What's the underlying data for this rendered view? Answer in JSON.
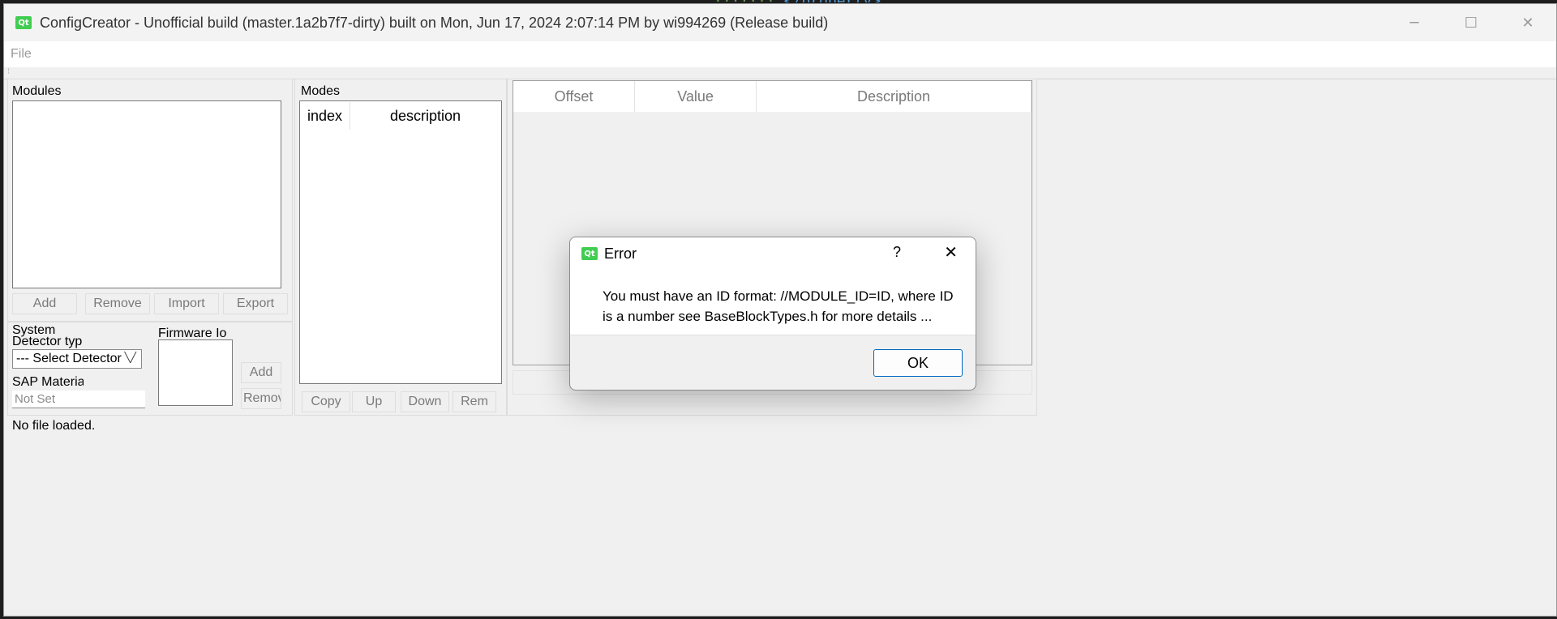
{
  "window": {
    "title": "ConfigCreator - Unofficial build (master.1a2b7f7-dirty) built on Mon, Jun 17, 2024  2:07:14 PM by wi994269 (Release build)",
    "logo": "Qt",
    "minimize_glyph": "─",
    "maximize_glyph": "☐",
    "close_glyph": "✕"
  },
  "menu": {
    "file": "File"
  },
  "modules": {
    "title": "Modules",
    "buttons": {
      "add": "Add",
      "remove": "Remove",
      "import": "Import",
      "export": "Export"
    }
  },
  "system": {
    "title": "System",
    "detector_type_label": "Detector typ",
    "detector_select_value": "--- Select Detector",
    "sap_material_label": "SAP Materia",
    "sap_material_placeholder": "Not Set",
    "firmware_label": "Firmware Io",
    "firmware_add": "Add",
    "firmware_remove": "Remov"
  },
  "modes": {
    "title": "Modes",
    "columns": {
      "index": "index",
      "description": "description"
    },
    "buttons": {
      "copy": "Copy",
      "up": "Up",
      "down": "Down",
      "remove": "Rem"
    }
  },
  "grid": {
    "columns": {
      "offset": "Offset",
      "value": "Value",
      "description": "Description"
    }
  },
  "status": {
    "text": "No file loaded."
  },
  "dialog": {
    "logo": "Qt",
    "title": "Error",
    "help": "?",
    "close_glyph": "✕",
    "message": "You must have an ID format: //MODULE_ID=ID, where ID is a number see BaseBlockTypes.h for more details ...",
    "ok": "OK"
  },
  "colors": {
    "qt_green": "#41cd52",
    "accent_blue": "#0067c0"
  }
}
